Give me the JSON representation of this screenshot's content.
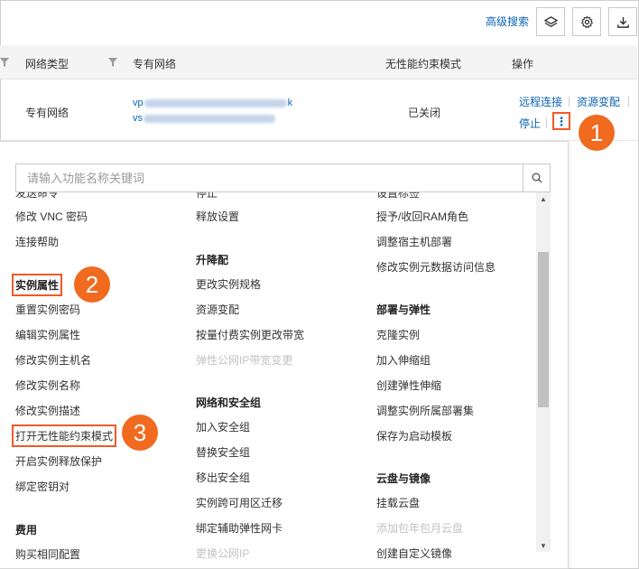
{
  "toolbar": {
    "advanced_search": "高级搜索"
  },
  "table": {
    "headers": [
      "网络类型",
      "专有网络",
      "无性能约束模式",
      "操作"
    ],
    "row": {
      "network_type": "专有网络",
      "vpc_prefix": "vp",
      "vpc_suffix": "k",
      "vsw_prefix": "vs",
      "perf_mode": "已关闭",
      "actions": [
        "远程连接",
        "资源变配",
        "停止"
      ],
      "more_icon": "⋮"
    }
  },
  "callouts": [
    "1",
    "2",
    "3"
  ],
  "dropdown": {
    "search_placeholder": "请输入功能名称关键词",
    "col1": {
      "items_top": [
        "发送命令",
        "修改 VNC 密码",
        "连接帮助"
      ],
      "group1": {
        "title": "实例属性",
        "items": [
          "重置实例密码",
          "编辑实例属性",
          "修改实例主机名",
          "修改实例名称",
          "修改实例描述",
          "打开无性能约束模式",
          "开启实例释放保护",
          "绑定密钥对"
        ]
      },
      "group2": {
        "title": "费用",
        "items": [
          "购买相同配置"
        ]
      }
    },
    "col2": {
      "items_top": [
        "停止",
        "释放设置"
      ],
      "group1": {
        "title": "升降配",
        "items": [
          "更改实例规格",
          "资源变配",
          "按量付费实例更改带宽"
        ],
        "disabled": [
          "弹性公网IP带宽变更"
        ]
      },
      "group2": {
        "title": "网络和安全组",
        "items": [
          "加入安全组",
          "替换安全组",
          "移出安全组",
          "实例跨可用区迁移",
          "绑定辅助弹性网卡"
        ],
        "disabled": [
          "更换公网IP"
        ]
      }
    },
    "col3": {
      "items_top": [
        "设置标签",
        "授予/收回RAM角色",
        "调整宿主机部署",
        "修改实例元数据访问信息"
      ],
      "group1": {
        "title": "部署与弹性",
        "items": [
          "克隆实例",
          "加入伸缩组",
          "创建弹性伸缩",
          "调整实例所属部署集",
          "保存为启动模板"
        ]
      },
      "group2": {
        "title": "云盘与镜像",
        "items": [
          "挂载云盘"
        ],
        "disabled": [
          "添加包年包月云盘"
        ],
        "items_after": [
          "创建自定义镜像"
        ]
      }
    }
  },
  "colors": {
    "link": "#0b64b5",
    "highlight": "#f05a28",
    "callout": "#f06a1f"
  }
}
